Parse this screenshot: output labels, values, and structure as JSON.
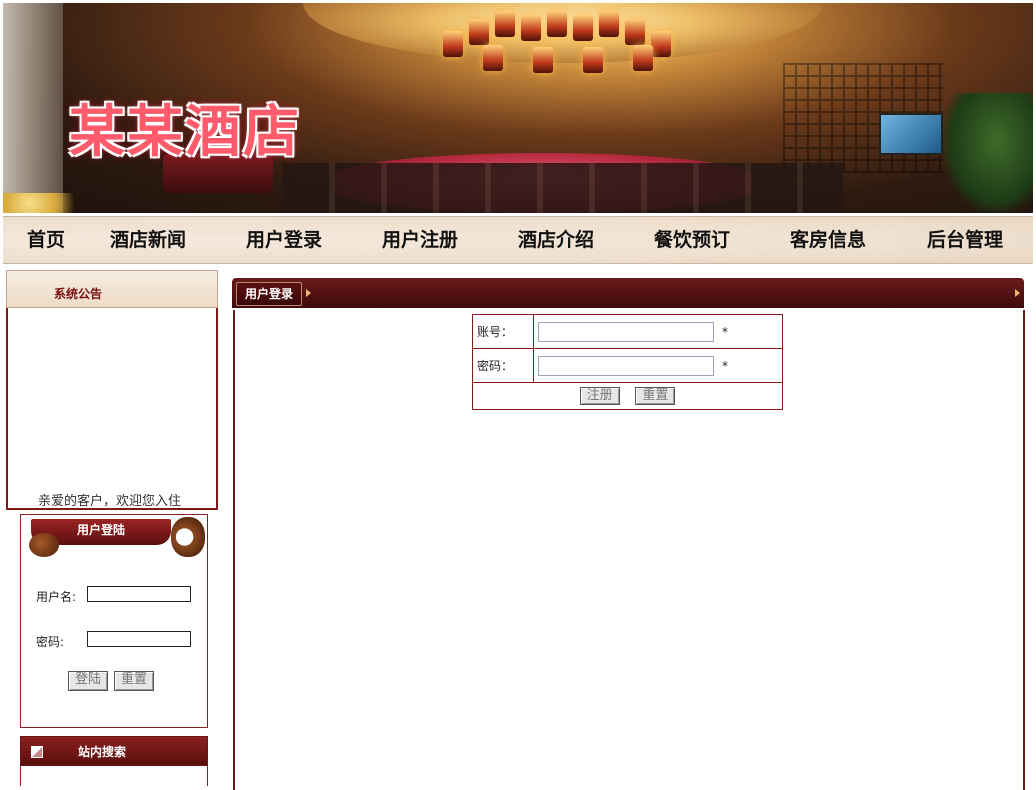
{
  "banner": {
    "title": "某某酒店"
  },
  "nav": {
    "items": [
      {
        "label": "首页"
      },
      {
        "label": "酒店新闻"
      },
      {
        "label": "用户登录"
      },
      {
        "label": "用户注册"
      },
      {
        "label": "酒店介绍"
      },
      {
        "label": "餐饮预订"
      },
      {
        "label": "客房信息"
      },
      {
        "label": "后台管理"
      }
    ]
  },
  "notice": {
    "title": "系统公告",
    "scroll_text": "亲爱的客户，欢迎您入住"
  },
  "sidebar_login": {
    "title": "用户登陆",
    "username_label": "用户名:",
    "username_value": "",
    "password_label": "密码:",
    "password_value": "",
    "login_button": "登陆",
    "reset_button": "重置"
  },
  "site_search": {
    "title": "站内搜索"
  },
  "main": {
    "tab_title": "用户登录",
    "form": {
      "account_label": "账号：",
      "account_value": "",
      "password_label": "密码：",
      "password_value": "",
      "required_mark": "*",
      "submit_button": "注册",
      "reset_button": "重置"
    }
  },
  "colors": {
    "brand_red": "#6a1b1b",
    "title_pink": "#ff5b6b",
    "nav_bg": "#efe0cf"
  }
}
